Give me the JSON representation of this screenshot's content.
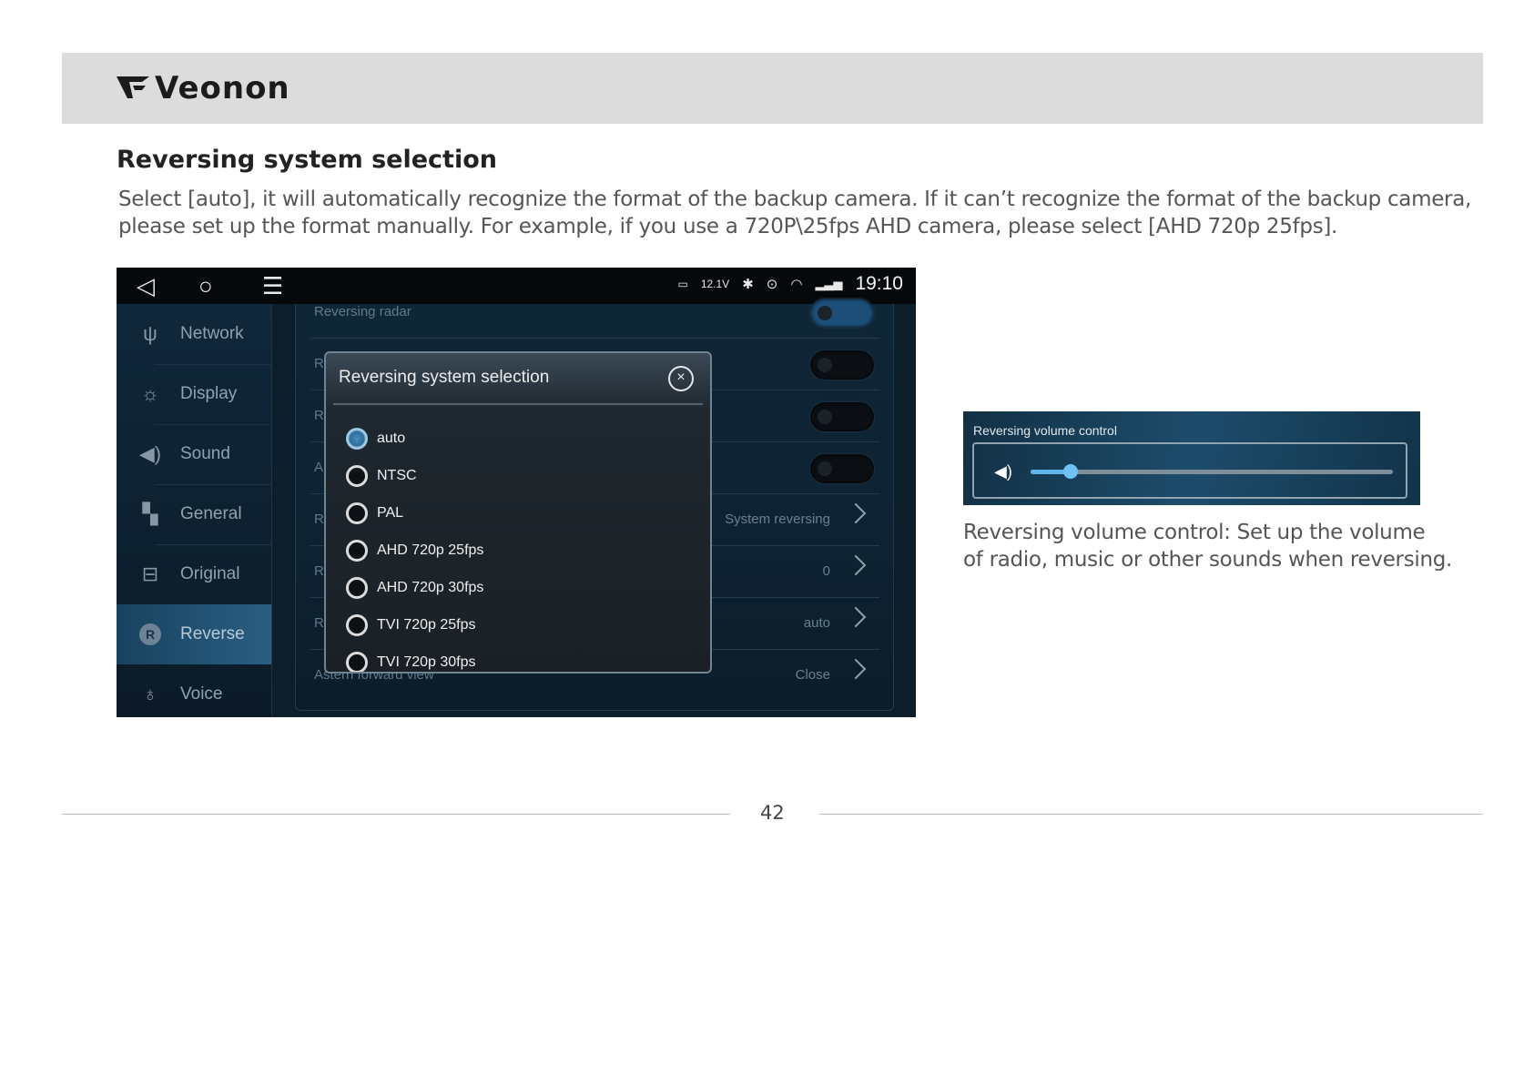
{
  "brand": {
    "logo_text": "Veonon"
  },
  "section": {
    "title": "Reversing system selection",
    "paragraph_lines": [
      "Select [auto], it will automatically recognize the format of the backup camera. If it can’t recognize the format of the backup camera,",
      "please set up the format manually. For example, if you use a 720P\\25fps AHD camera, please select [AHD 720p 25fps]."
    ]
  },
  "device": {
    "statusbar": {
      "voltage": "12.1V",
      "time": "19:10"
    },
    "sidebar": [
      {
        "label": "Network",
        "icon": "antenna-icon"
      },
      {
        "label": "Display",
        "icon": "sun-icon"
      },
      {
        "label": "Sound",
        "icon": "speaker-icon"
      },
      {
        "label": "General",
        "icon": "grid-icon"
      },
      {
        "label": "Original",
        "icon": "car-icon"
      },
      {
        "label": "Reverse",
        "icon": "reverse-icon",
        "active": true
      },
      {
        "label": "Voice",
        "icon": "microphone-icon"
      }
    ],
    "rows": [
      {
        "label": "Reversing radar",
        "value": "",
        "control": "toggle"
      },
      {
        "label": "R",
        "value": "",
        "control": "toggle"
      },
      {
        "label": "R",
        "value": "",
        "control": "toggle"
      },
      {
        "label": "A",
        "value": "",
        "control": "toggle"
      },
      {
        "label": "R",
        "value": "System reversing",
        "control": "chevron"
      },
      {
        "label": "R",
        "value": "0",
        "control": "chevron"
      },
      {
        "label": "R",
        "value": "auto",
        "control": "chevron"
      },
      {
        "label": "Astern forward view",
        "value": "Close",
        "control": "chevron"
      }
    ],
    "dialog": {
      "title": "Reversing system selection",
      "options": [
        "auto",
        "NTSC",
        "PAL",
        "AHD 720p 25fps",
        "AHD 720p 30fps",
        "TVI 720p 25fps",
        "TVI 720p 30fps"
      ],
      "selected": "auto"
    }
  },
  "volume": {
    "title": "Reversing volume control",
    "level_fraction": 0.11,
    "caption_lines": [
      "Reversing volume control: Set up the volume",
      "of radio, music or other sounds when reversing."
    ]
  },
  "footer": {
    "page_number": "42"
  }
}
